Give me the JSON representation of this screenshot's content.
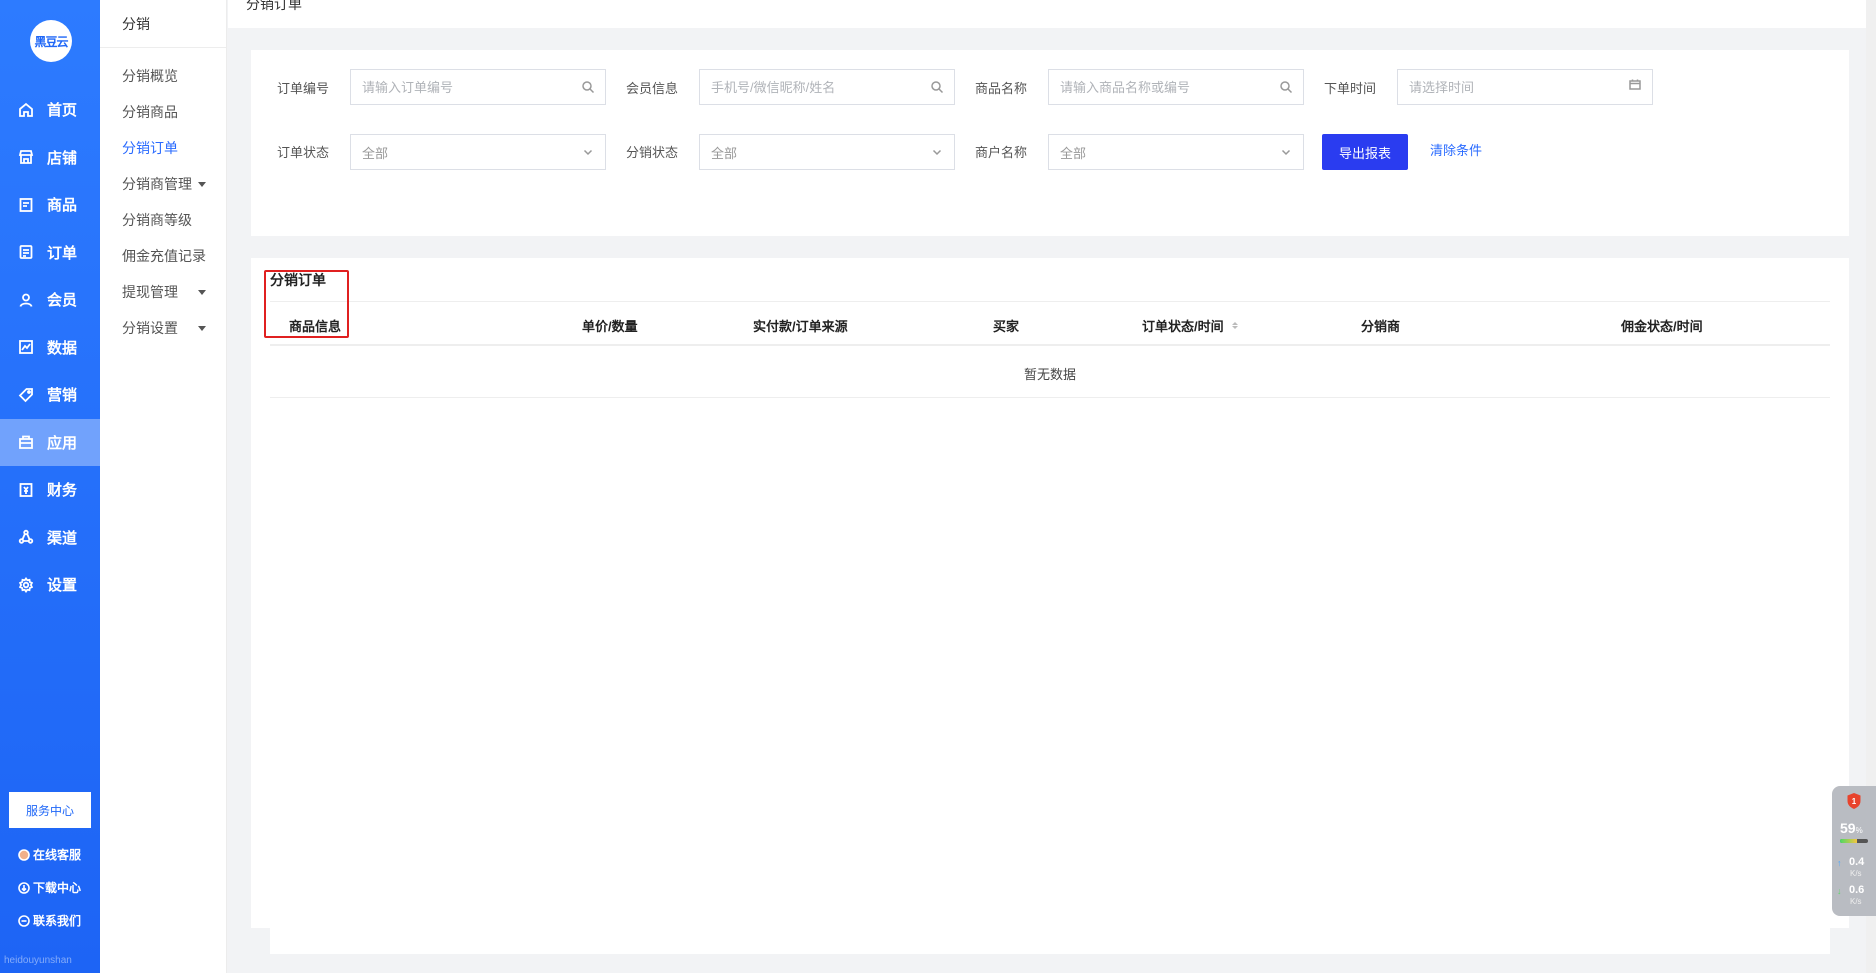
{
  "logo": {
    "text": "黑豆云"
  },
  "sidebar": {
    "items": [
      {
        "label": "首页",
        "icon": "home-icon"
      },
      {
        "label": "店铺",
        "icon": "store-icon"
      },
      {
        "label": "商品",
        "icon": "goods-icon"
      },
      {
        "label": "订单",
        "icon": "order-icon"
      },
      {
        "label": "会员",
        "icon": "user-icon"
      },
      {
        "label": "数据",
        "icon": "chart-icon"
      },
      {
        "label": "营销",
        "icon": "tag-icon"
      },
      {
        "label": "应用",
        "icon": "app-icon",
        "active": true
      },
      {
        "label": "财务",
        "icon": "finance-icon"
      },
      {
        "label": "渠道",
        "icon": "channel-icon"
      },
      {
        "label": "设置",
        "icon": "gear-icon"
      }
    ],
    "service_center": "服务中心",
    "online_service": "在线客服",
    "download_center": "下载中心",
    "contact_us": "联系我们",
    "watermark": "heidouyunshan"
  },
  "submenu": {
    "title": "分销",
    "items": [
      {
        "label": "分销概览"
      },
      {
        "label": "分销商品"
      },
      {
        "label": "分销订单",
        "active": true
      },
      {
        "label": "分销商管理",
        "has_caret": true
      },
      {
        "label": "分销商等级"
      },
      {
        "label": "佣金充值记录"
      },
      {
        "label": "提现管理",
        "has_caret": true
      },
      {
        "label": "分销设置",
        "has_caret": true
      }
    ]
  },
  "header": {
    "title": "分销订单"
  },
  "filters": {
    "order_no": {
      "label": "订单编号",
      "placeholder": "请输入订单编号"
    },
    "member": {
      "label": "会员信息",
      "placeholder": "手机号/微信昵称/姓名"
    },
    "product": {
      "label": "商品名称",
      "placeholder": "请输入商品名称或编号"
    },
    "order_time": {
      "label": "下单时间",
      "placeholder": "请选择时间"
    },
    "order_status": {
      "label": "订单状态",
      "value": "全部"
    },
    "dist_status": {
      "label": "分销状态",
      "value": "全部"
    },
    "merchant": {
      "label": "商户名称",
      "value": "全部"
    },
    "export_label": "导出报表",
    "clear_label": "清除条件"
  },
  "table": {
    "title": "分销订单",
    "columns": [
      "商品信息",
      "单价/数量",
      "实付款/订单来源",
      "买家",
      "订单状态/时间",
      "分销商",
      "佣金状态/时间"
    ],
    "empty_text": "暂无数据"
  },
  "monitor": {
    "alert_count": "1",
    "cpu_percent": "59",
    "cpu_unit": "%",
    "cpu_fraction": 0.59,
    "upload": "0.4",
    "download": "0.6",
    "speed_unit": "K/s"
  }
}
